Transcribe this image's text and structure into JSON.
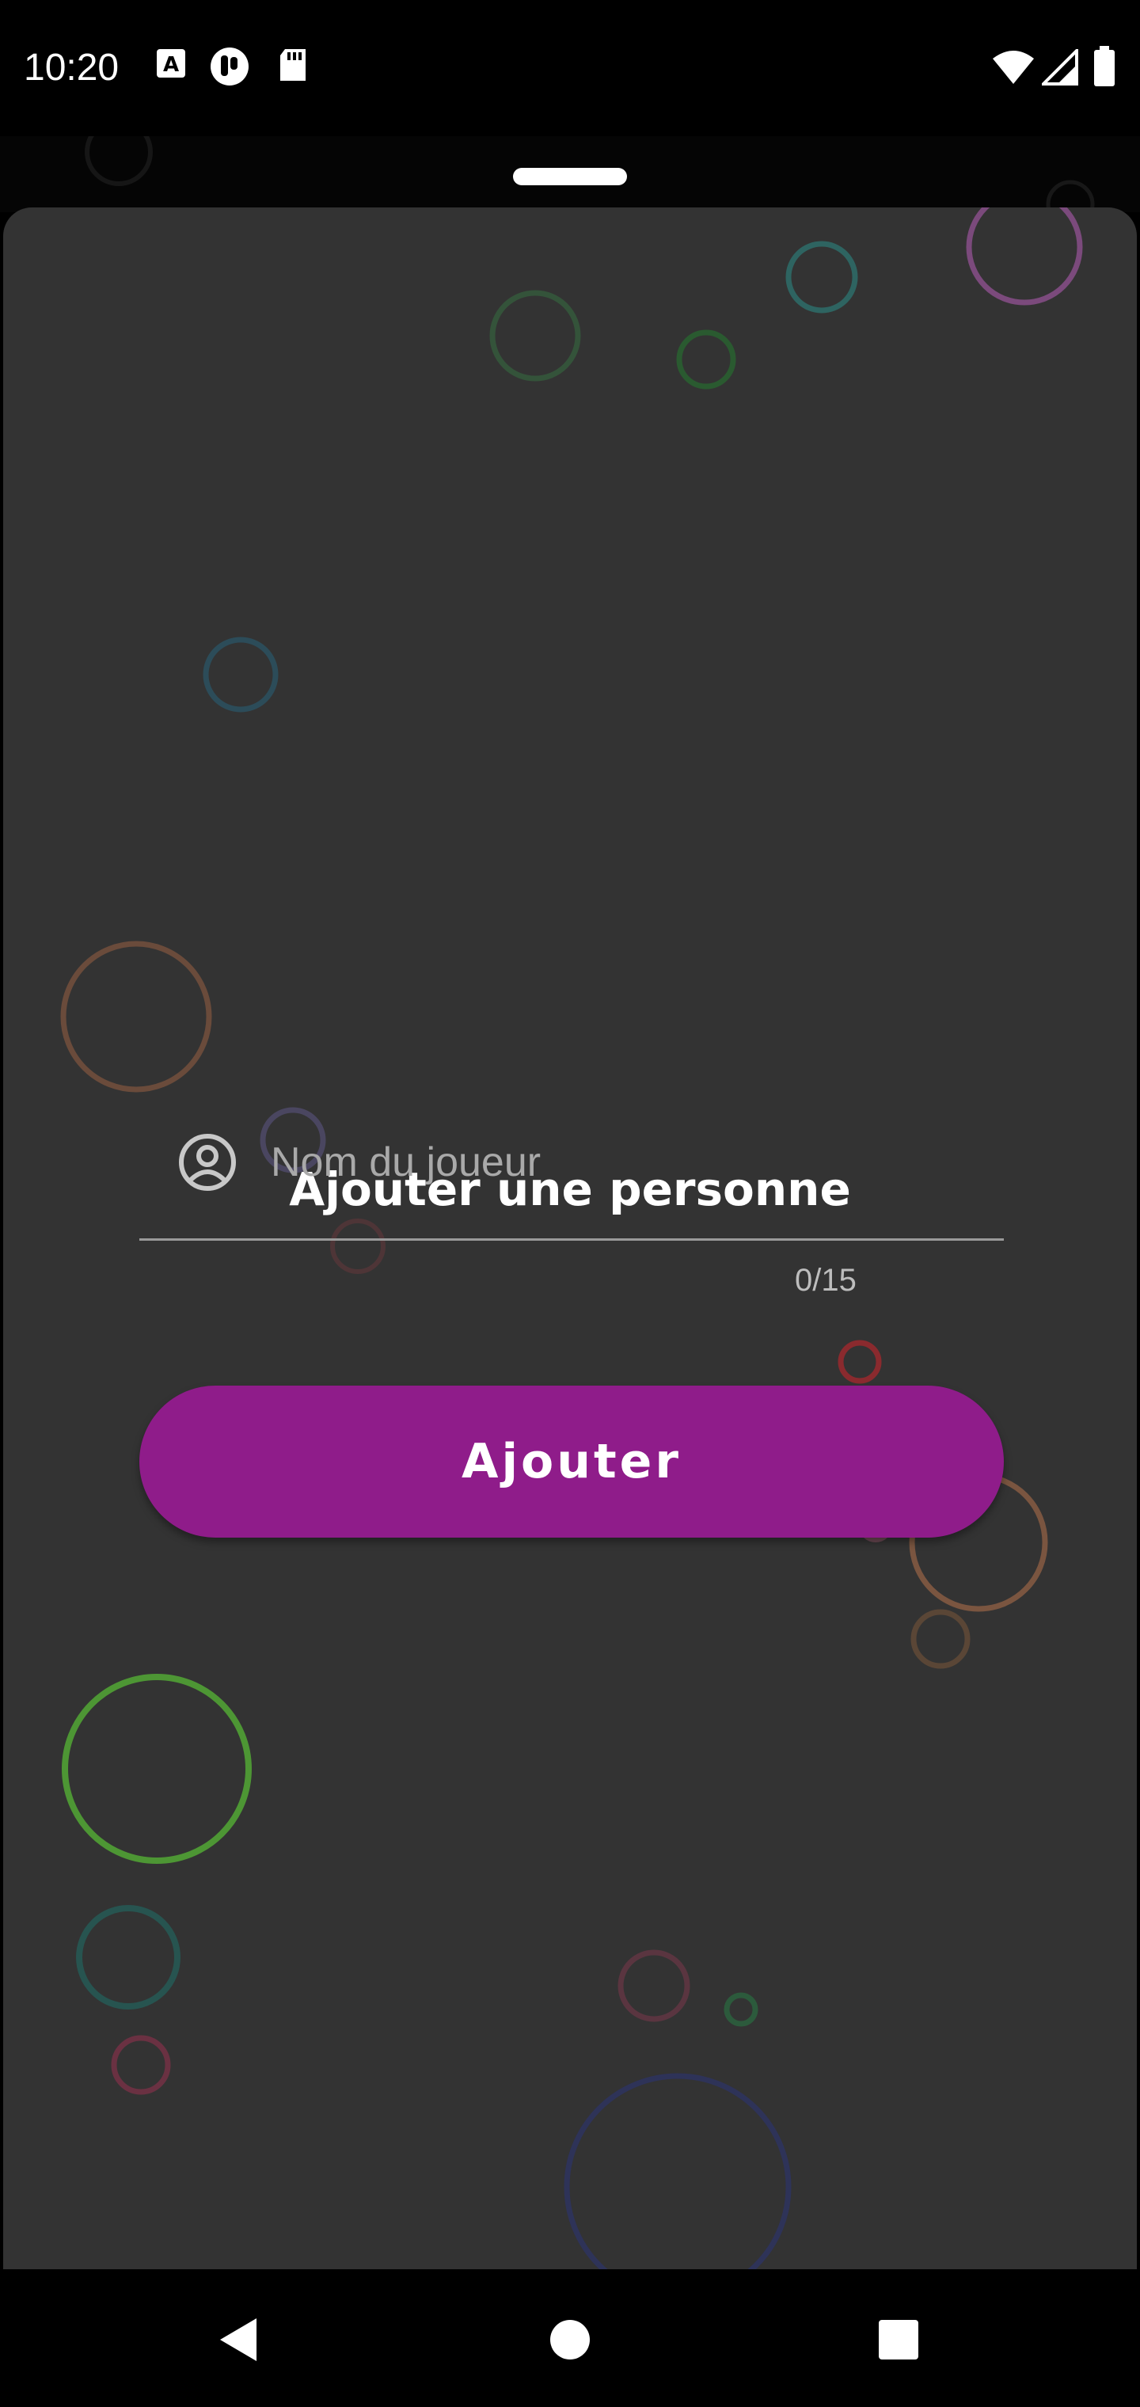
{
  "status_bar": {
    "time": "10:20",
    "notification_icons": [
      "a-icon",
      "fold-icon",
      "sd-card-icon"
    ],
    "system_icons": [
      "wifi-icon",
      "signal-icon",
      "battery-icon"
    ]
  },
  "sheet": {
    "title": "Ajouter une personne",
    "name_input": {
      "placeholder": "Nom du joueur",
      "value": "",
      "icon": "account-circle-icon"
    },
    "char_counter": "0/15",
    "add_button_label": "Ajouter"
  },
  "colors": {
    "sheet_background": "#333333",
    "accent": "#8f1c8a",
    "screen_background": "#000000"
  },
  "nav_bar": {
    "buttons": [
      "back-icon",
      "home-icon",
      "recents-icon"
    ]
  }
}
